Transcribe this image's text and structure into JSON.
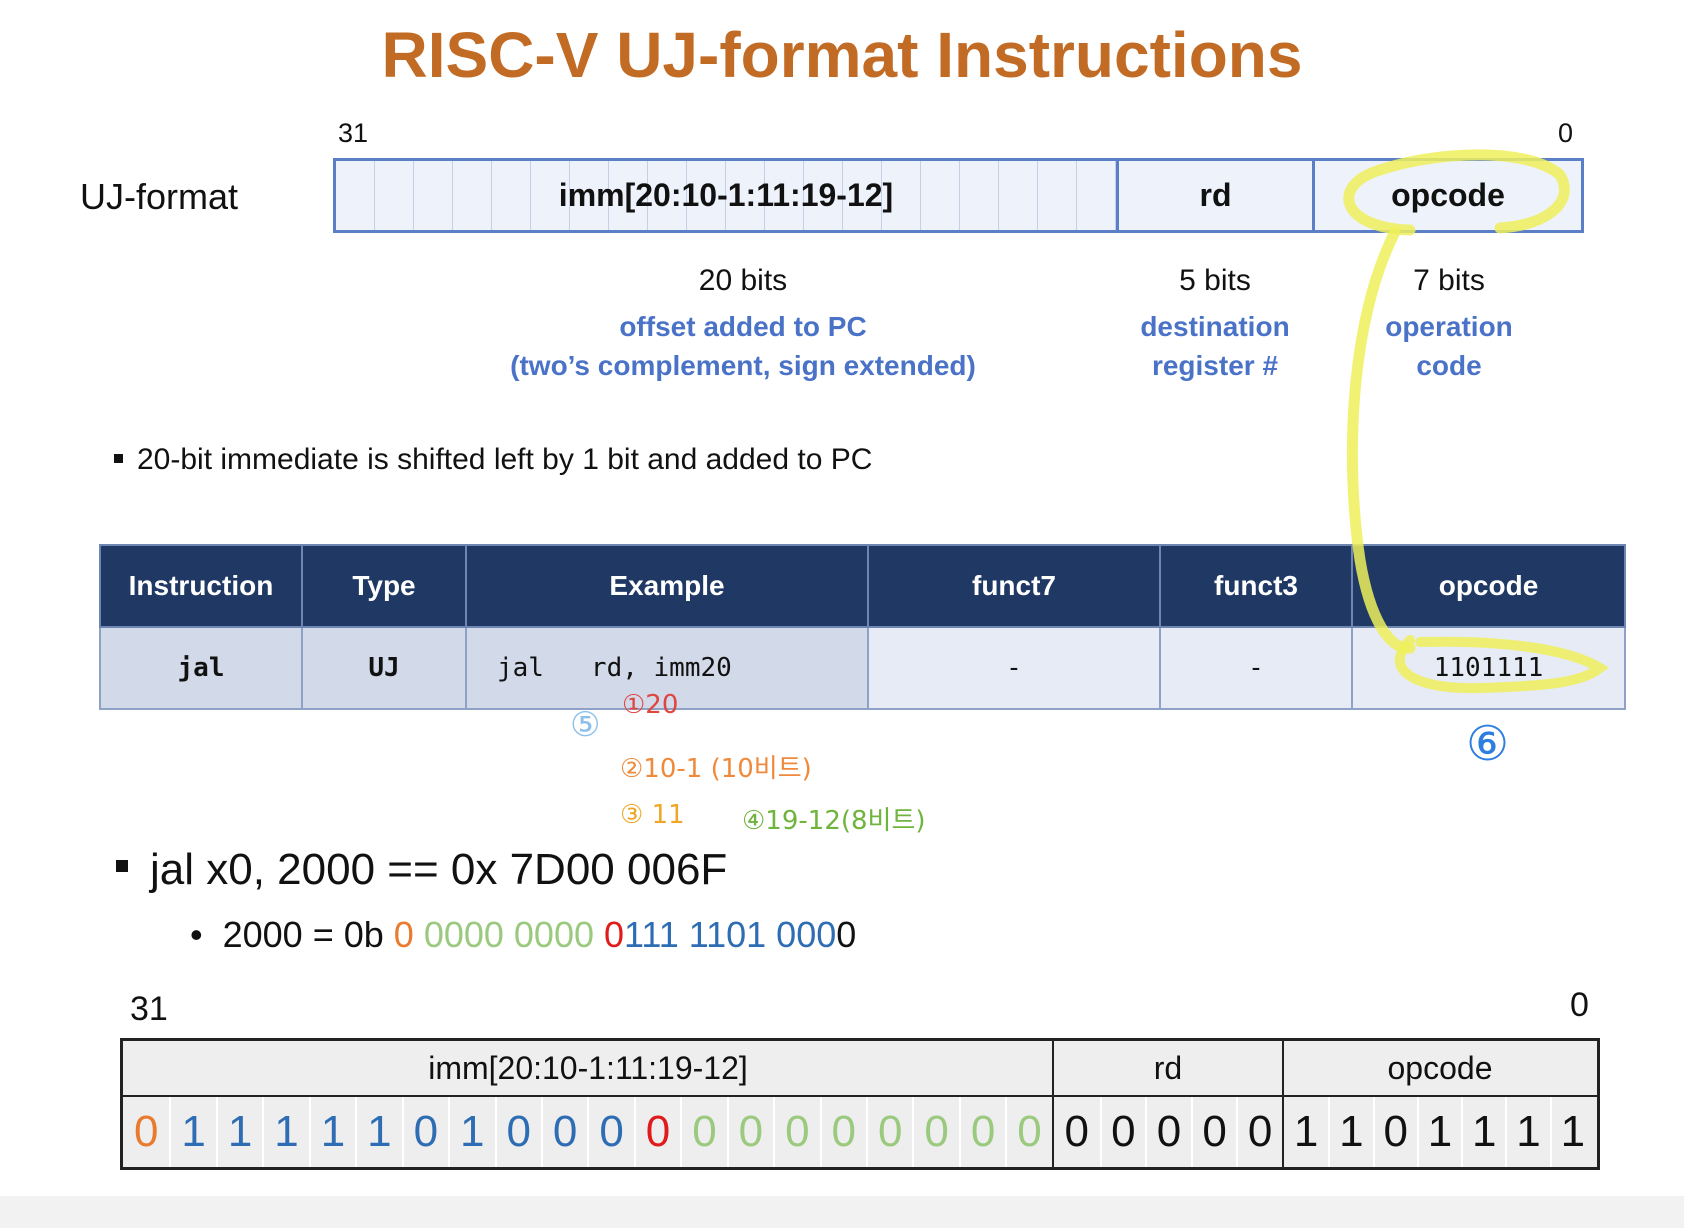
{
  "title": "RISC-V UJ-format Instructions",
  "format": {
    "label": "UJ-format",
    "bit_high": "31",
    "bit_low": "0",
    "fields": [
      {
        "name": "imm[20:10-1:11:19-12]",
        "bits": "20 bits",
        "desc1": "offset added to PC",
        "desc2": "(two’s complement, sign extended)"
      },
      {
        "name": "rd",
        "bits": "5 bits",
        "desc1": "destination",
        "desc2": "register #"
      },
      {
        "name": "opcode",
        "bits": "7 bits",
        "desc1": "operation",
        "desc2": "code"
      }
    ]
  },
  "note": "20-bit immediate is shifted left by 1 bit and added to PC",
  "table": {
    "headers": [
      "Instruction",
      "Type",
      "Example",
      "funct7",
      "funct3",
      "opcode"
    ],
    "row": [
      "jal",
      "UJ",
      "jal   rd, imm20",
      "-",
      "-",
      "1101111"
    ]
  },
  "annotations": {
    "a5": "⑤",
    "a1": "①20",
    "a2": "②10-1 (10비트)",
    "a3": "③ 11",
    "a4": "④19-12(8비트)",
    "a6": "⑥"
  },
  "example": {
    "main": "jal x0, 2000 == 0x 7D00 006F",
    "sub_prefix": "2000 = 0b ",
    "binary_groups": [
      {
        "text": "0 ",
        "color": "orange"
      },
      {
        "text": "0000 0000 ",
        "color": "green"
      },
      {
        "text": "0",
        "color": "red"
      },
      {
        "text": "111 1101 000",
        "color": "blue"
      },
      {
        "text": "0",
        "color": "black"
      }
    ]
  },
  "encoding": {
    "bit_high": "31",
    "bit_low": "0",
    "headers": [
      "imm[20:10-1:11:19-12]",
      "rd",
      "opcode"
    ],
    "imm_bits": [
      {
        "v": "0",
        "c": "orange"
      },
      {
        "v": "1",
        "c": "blue"
      },
      {
        "v": "1",
        "c": "blue"
      },
      {
        "v": "1",
        "c": "blue"
      },
      {
        "v": "1",
        "c": "blue"
      },
      {
        "v": "1",
        "c": "blue"
      },
      {
        "v": "0",
        "c": "blue"
      },
      {
        "v": "1",
        "c": "blue"
      },
      {
        "v": "0",
        "c": "blue"
      },
      {
        "v": "0",
        "c": "blue"
      },
      {
        "v": "0",
        "c": "blue"
      },
      {
        "v": "0",
        "c": "red"
      },
      {
        "v": "0",
        "c": "green"
      },
      {
        "v": "0",
        "c": "green"
      },
      {
        "v": "0",
        "c": "green"
      },
      {
        "v": "0",
        "c": "green"
      },
      {
        "v": "0",
        "c": "green"
      },
      {
        "v": "0",
        "c": "green"
      },
      {
        "v": "0",
        "c": "green"
      },
      {
        "v": "0",
        "c": "green"
      }
    ],
    "rd_bits": [
      "0",
      "0",
      "0",
      "0",
      "0"
    ],
    "opcode_bits": [
      "1",
      "1",
      "0",
      "1",
      "1",
      "1",
      "1"
    ]
  },
  "colors": {
    "title": "#c26b25",
    "description": "#4a73c8",
    "table_header": "#1f3864",
    "highlight": "#f2f05a",
    "orange": "#e87b2e",
    "green": "#9bca7f",
    "red": "#e01b1b",
    "blue": "#2e6db4"
  }
}
